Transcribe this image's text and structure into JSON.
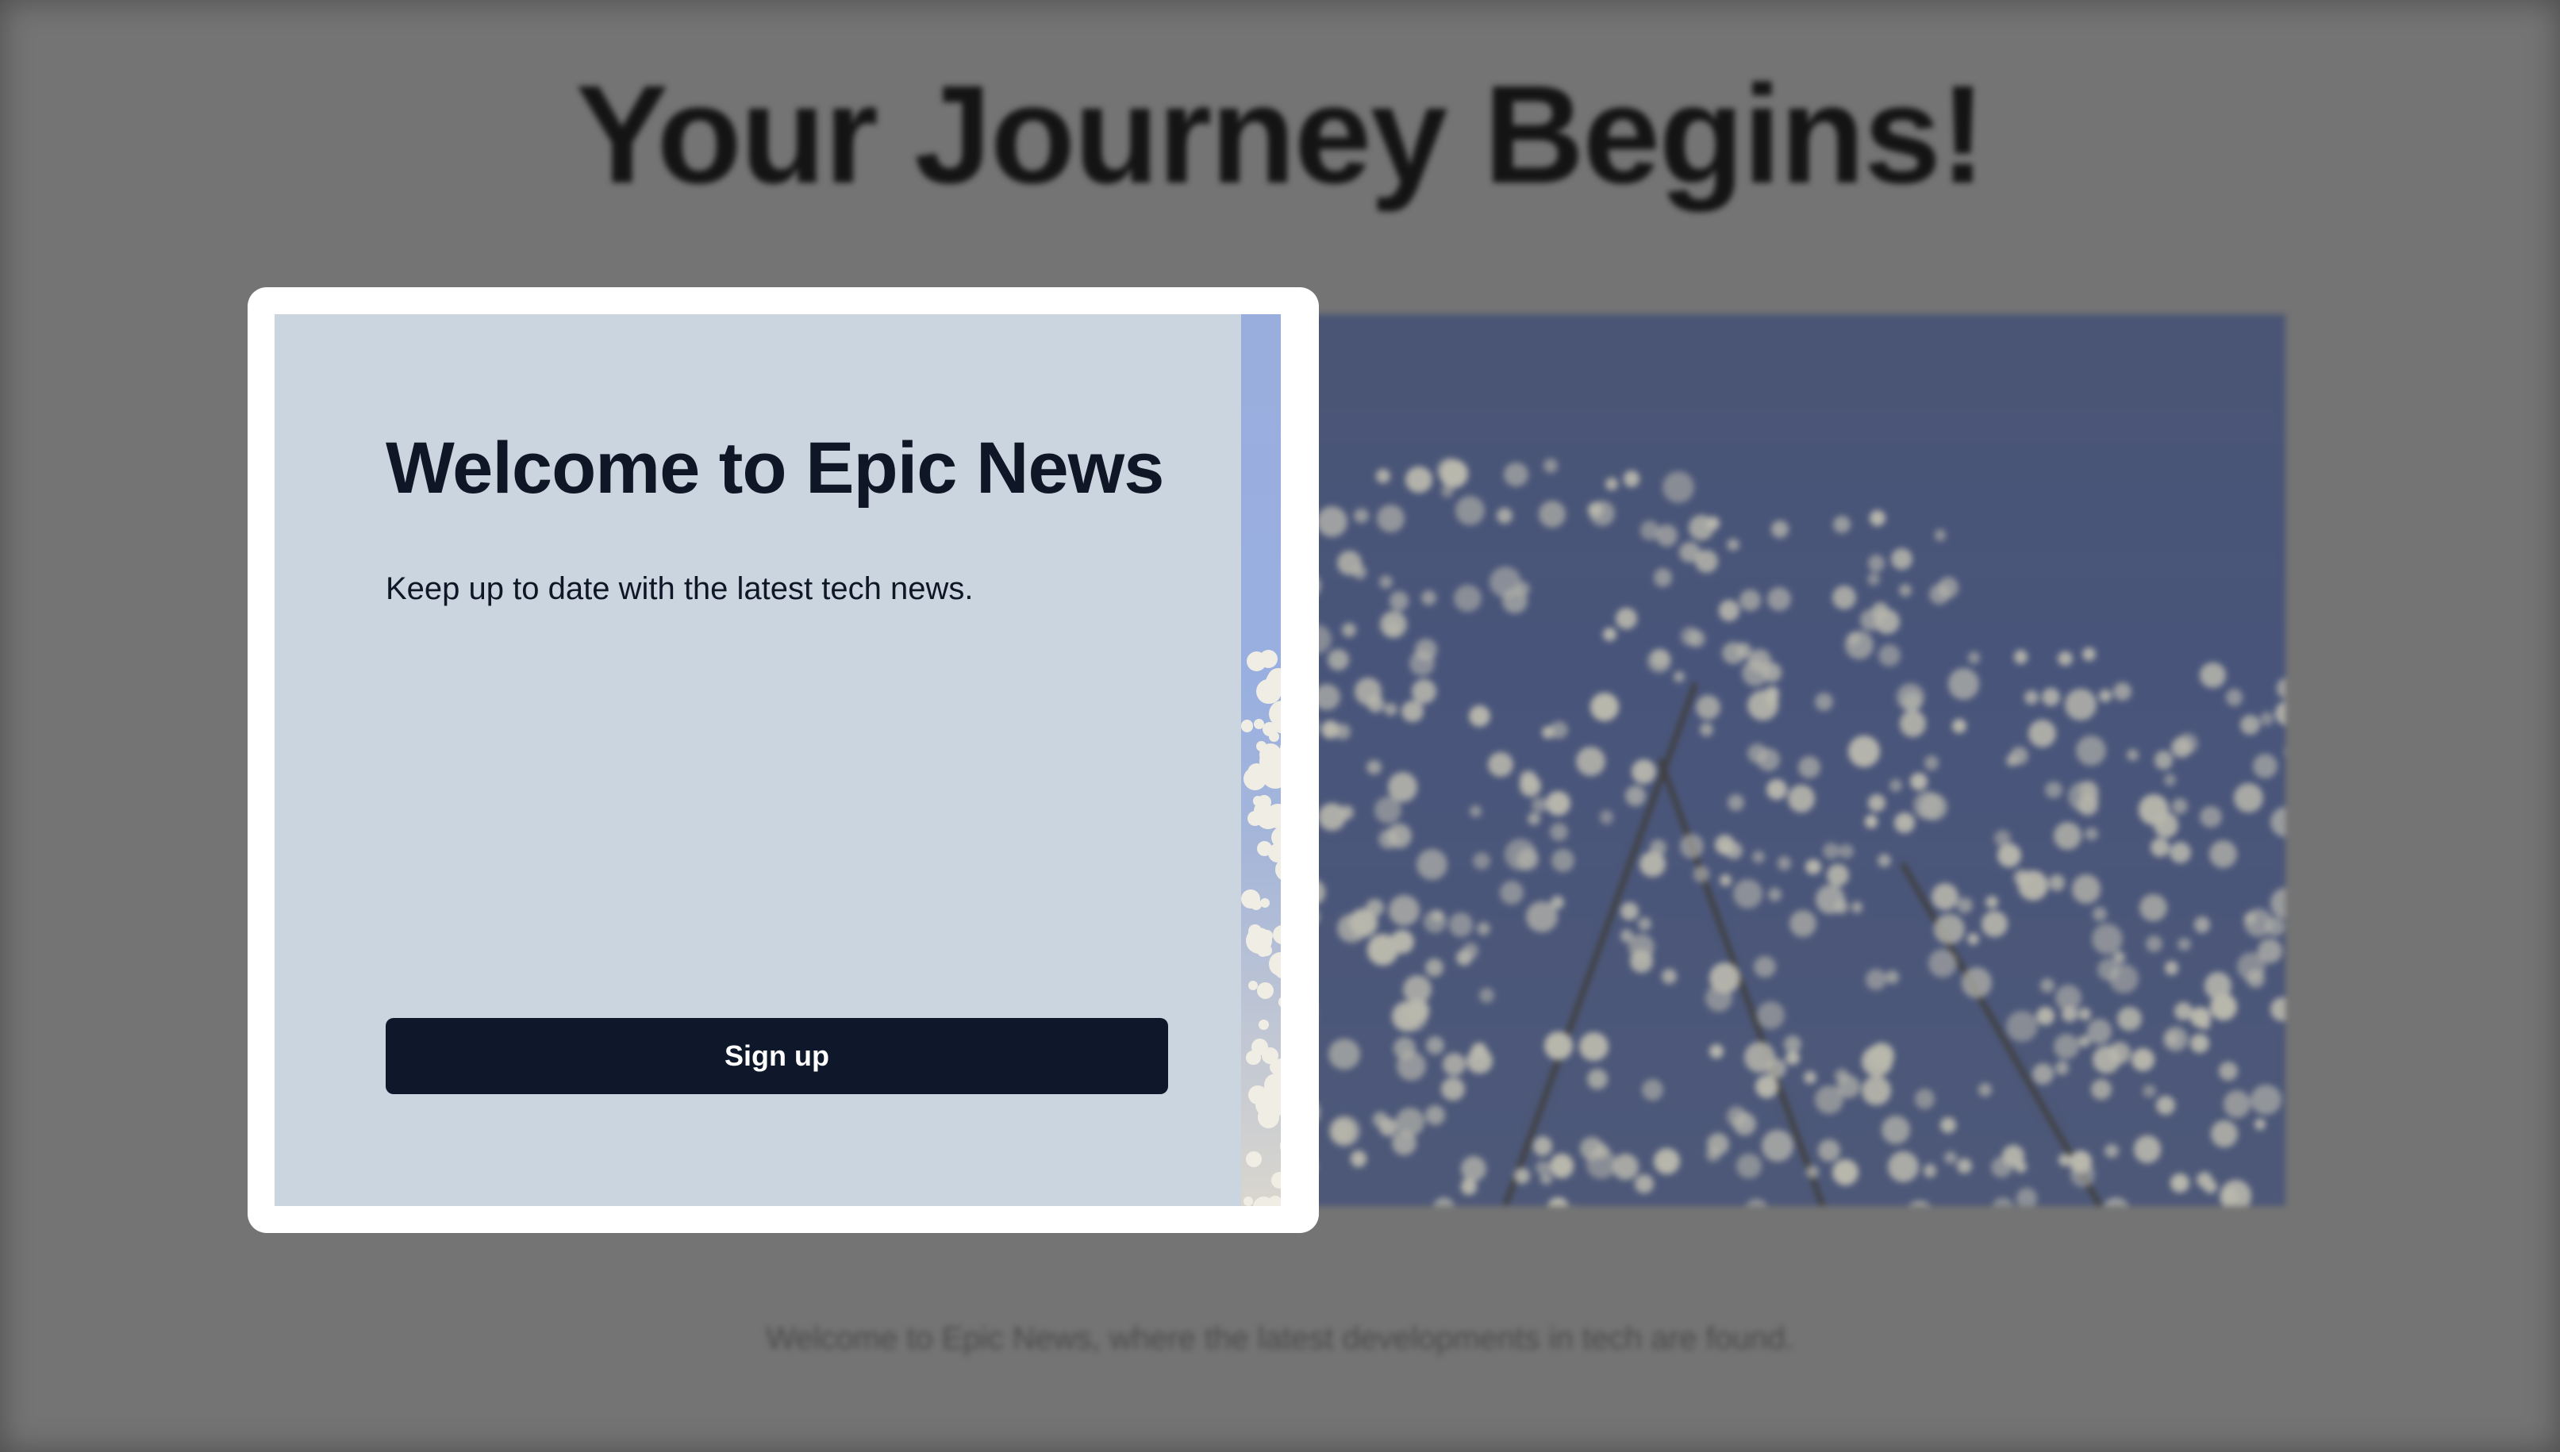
{
  "background_page": {
    "title": "Your Journey Begins!",
    "footer_text": "Welcome to Epic News, where the latest developments in tech are found."
  },
  "modal": {
    "title": "Welcome to Epic News",
    "text": "Keep up to date with the latest tech news.",
    "signup_label": "Sign up"
  },
  "colors": {
    "overlay": "#747474",
    "modal_background": "#ffffff",
    "panel_background": "#cbd5df",
    "button_background": "#0f172a",
    "button_text": "#ffffff",
    "title_text": "#0f1626"
  }
}
